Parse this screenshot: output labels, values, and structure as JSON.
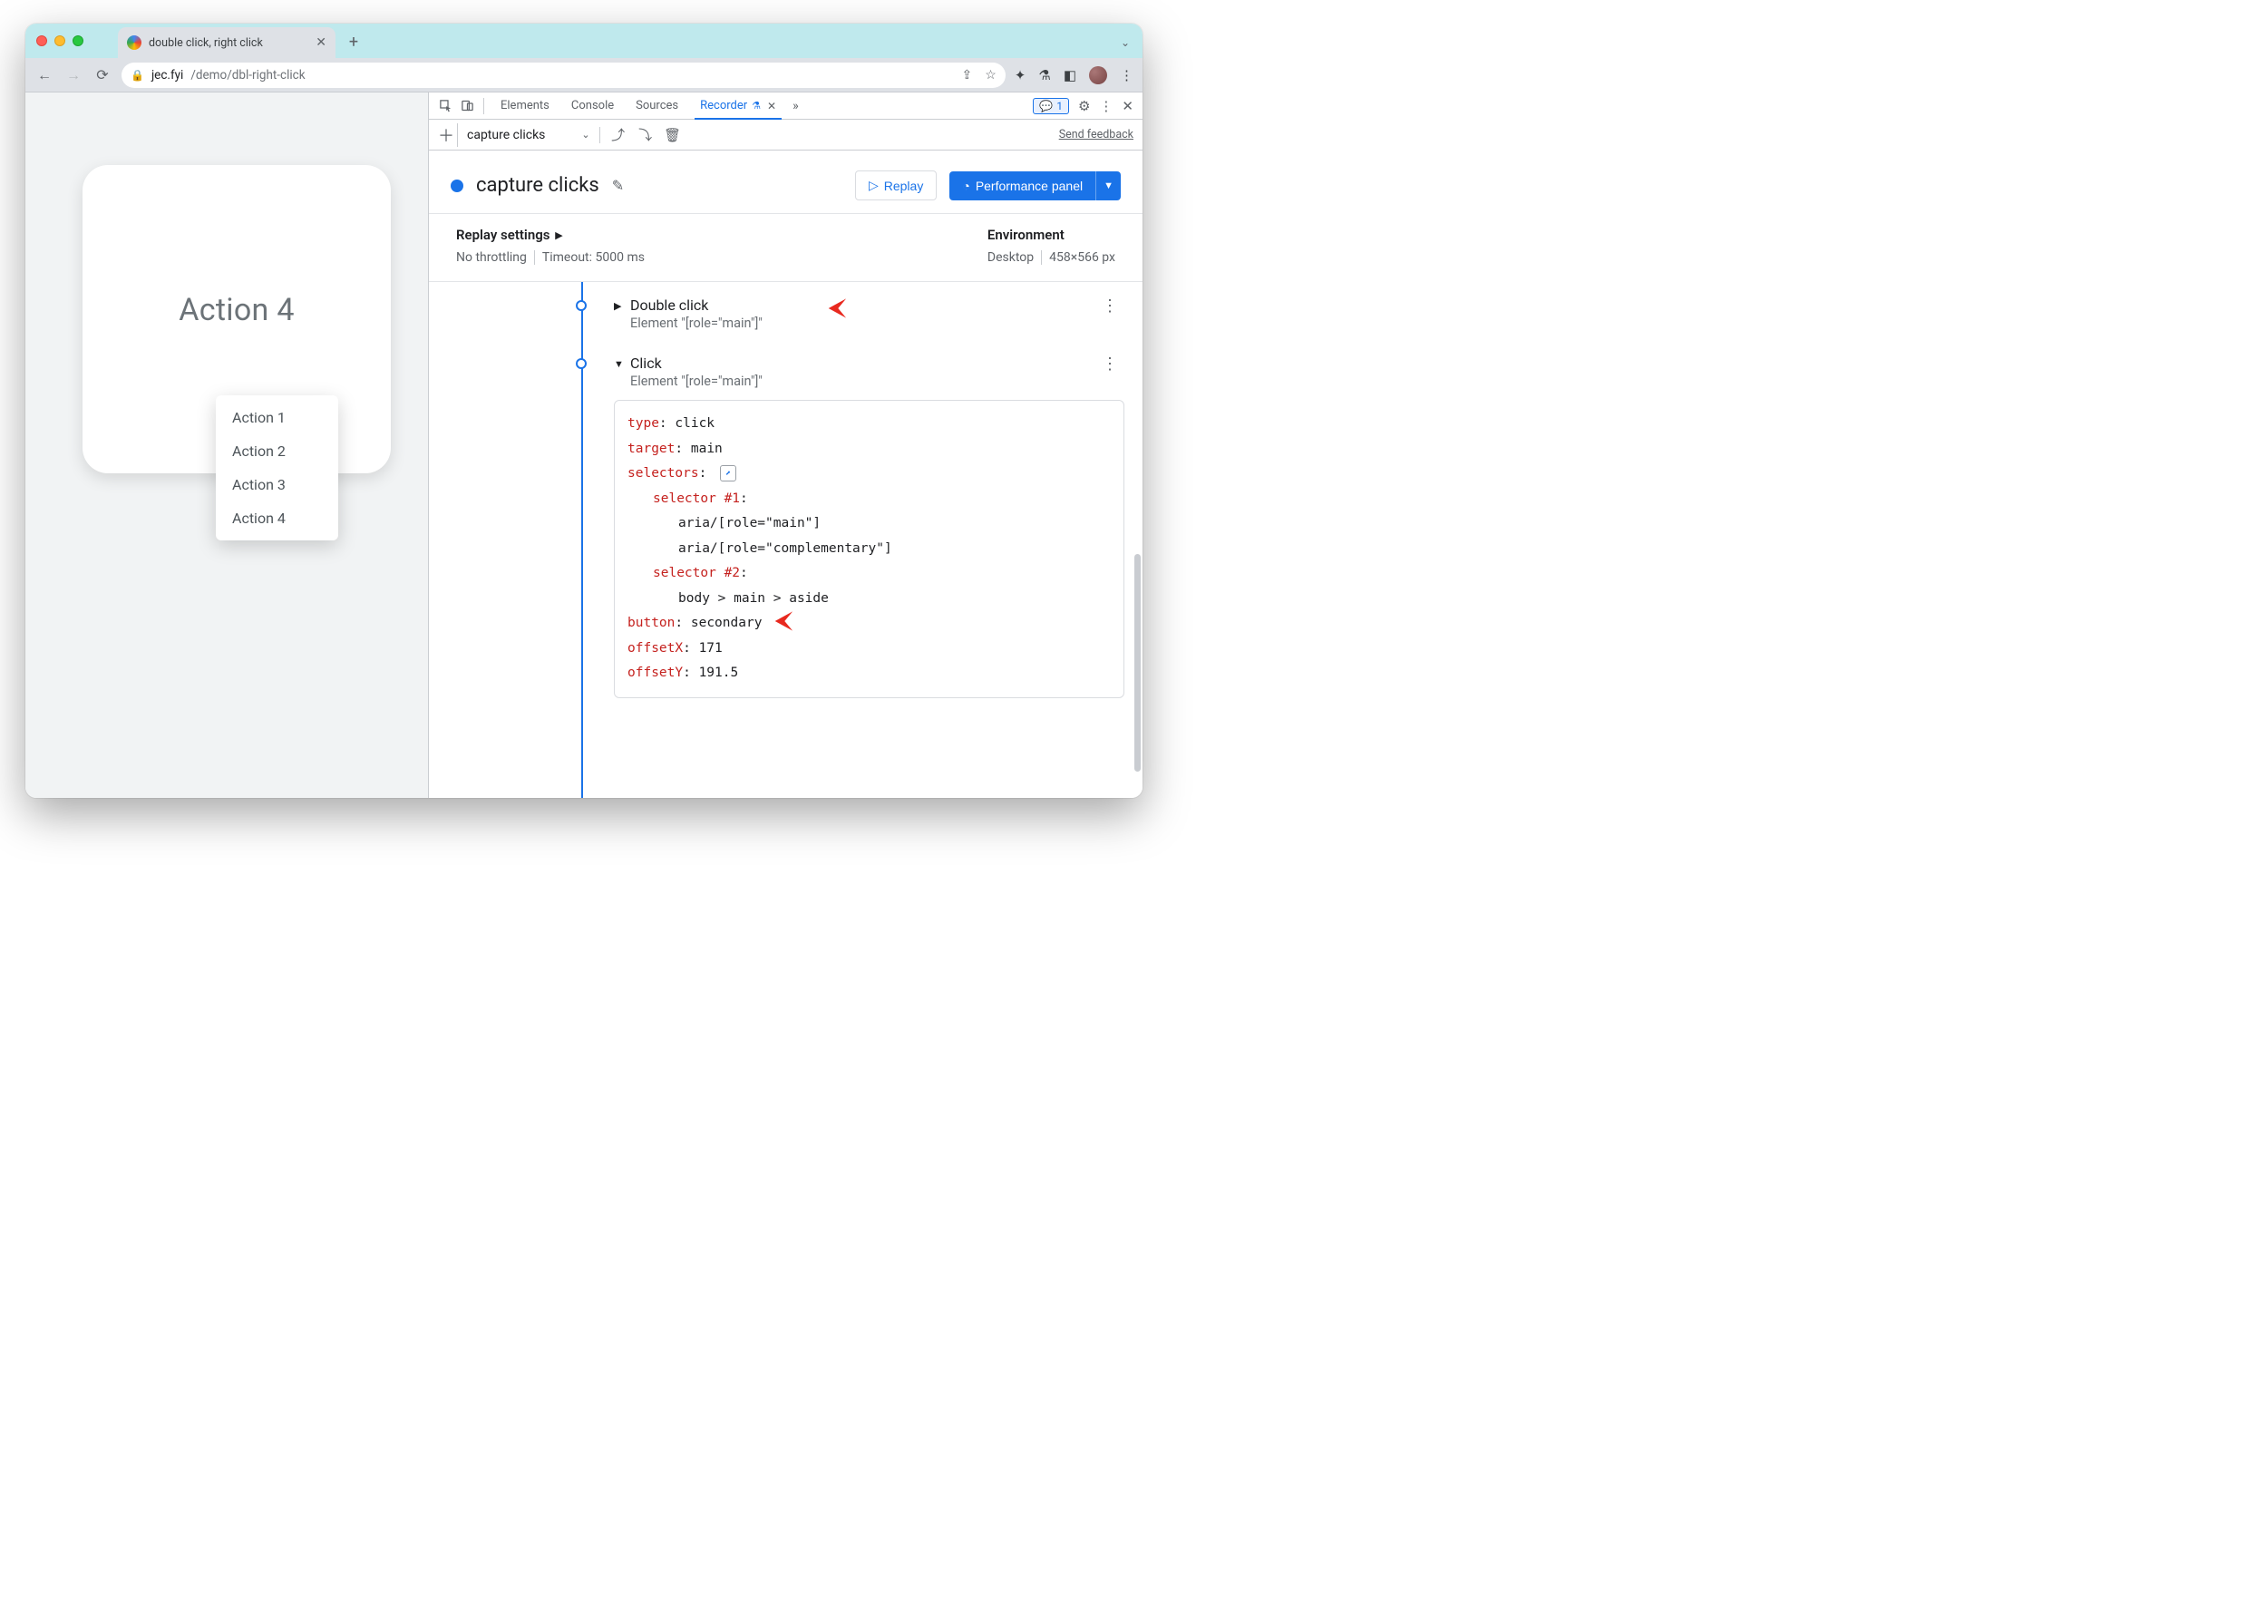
{
  "browser": {
    "tab_title": "double click, right click",
    "url_domain": "jec.fyi",
    "url_path": "/demo/dbl-right-click"
  },
  "page": {
    "card_title": "Action 4",
    "menu_items": [
      "Action 1",
      "Action 2",
      "Action 3",
      "Action 4"
    ]
  },
  "devtools": {
    "tabs": {
      "elements": "Elements",
      "console": "Console",
      "sources": "Sources",
      "recorder": "Recorder"
    },
    "issues_count": "1",
    "recorder": {
      "toolbar_selection": "capture clicks",
      "send_feedback": "Send feedback",
      "recording_name": "capture clicks",
      "replay_btn": "Replay",
      "perf_btn": "Performance panel",
      "replay_settings_label": "Replay settings",
      "throttling": "No throttling",
      "timeout_label": "Timeout: 5000 ms",
      "environment_label": "Environment",
      "env_device": "Desktop",
      "env_viewport": "458×566 px",
      "steps": [
        {
          "title": "Double click",
          "subtitle": "Element \"[role=\"main\"]\"",
          "expanded": false
        },
        {
          "title": "Click",
          "subtitle": "Element \"[role=\"main\"]\"",
          "expanded": true,
          "details": {
            "type_label": "type",
            "type_value": "click",
            "target_label": "target",
            "target_value": "main",
            "selectors_label": "selectors",
            "sel1_label": "selector #1",
            "sel1_a": "aria/[role=\"main\"]",
            "sel1_b": "aria/[role=\"complementary\"]",
            "sel2_label": "selector #2",
            "sel2_a": "body > main > aside",
            "button_label": "button",
            "button_value": "secondary",
            "offsetX_label": "offsetX",
            "offsetX_value": "171",
            "offsetY_label": "offsetY",
            "offsetY_value": "191.5"
          }
        }
      ]
    }
  }
}
